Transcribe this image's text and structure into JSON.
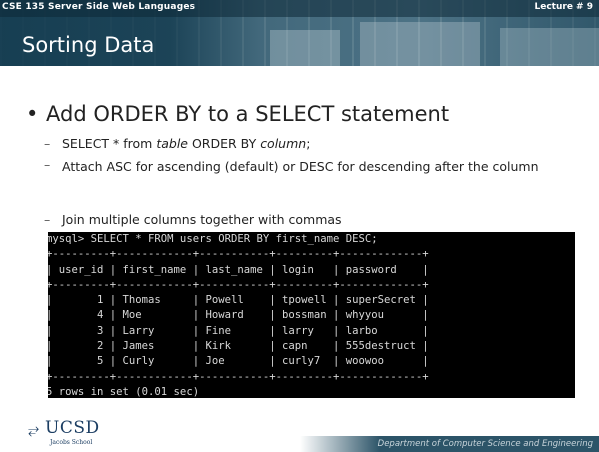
{
  "header": {
    "course": "CSE 135   Server Side Web Languages",
    "lecture": "Lecture # 9",
    "title": "Sorting Data"
  },
  "bullet": "Add ORDER BY to a SELECT statement",
  "subpoints": {
    "syntax_prefix": "SELECT * from ",
    "syntax_table": "table",
    "syntax_mid": " ORDER BY ",
    "syntax_column": "column",
    "syntax_end": ";",
    "asc_desc": "Attach ASC for ascending (default) or DESC for descending after the column",
    "join": "Join multiple columns together with commas"
  },
  "terminal": {
    "lines": [
      "mysql> SELECT * FROM users ORDER BY first_name DESC;",
      "+---------+------------+-----------+---------+-------------+",
      "| user_id | first_name | last_name | login   | password    |",
      "+---------+------------+-----------+---------+-------------+",
      "|       1 | Thomas     | Powell    | tpowell | superSecret |",
      "|       4 | Moe        | Howard    | bossman | whyyou      |",
      "|       3 | Larry      | Fine      | larry   | larbo       |",
      "|       2 | James      | Kirk      | capn    | 555destruct |",
      "|       5 | Curly      | Joe       | curly7  | woowoo      |",
      "+---------+------------+-----------+---------+-------------+",
      "5 rows in set (0.01 sec)"
    ]
  },
  "footer": {
    "logo_word": "UCSD",
    "logo_school": "Jacobs School",
    "department": "Department of Computer Science and Engineering"
  }
}
